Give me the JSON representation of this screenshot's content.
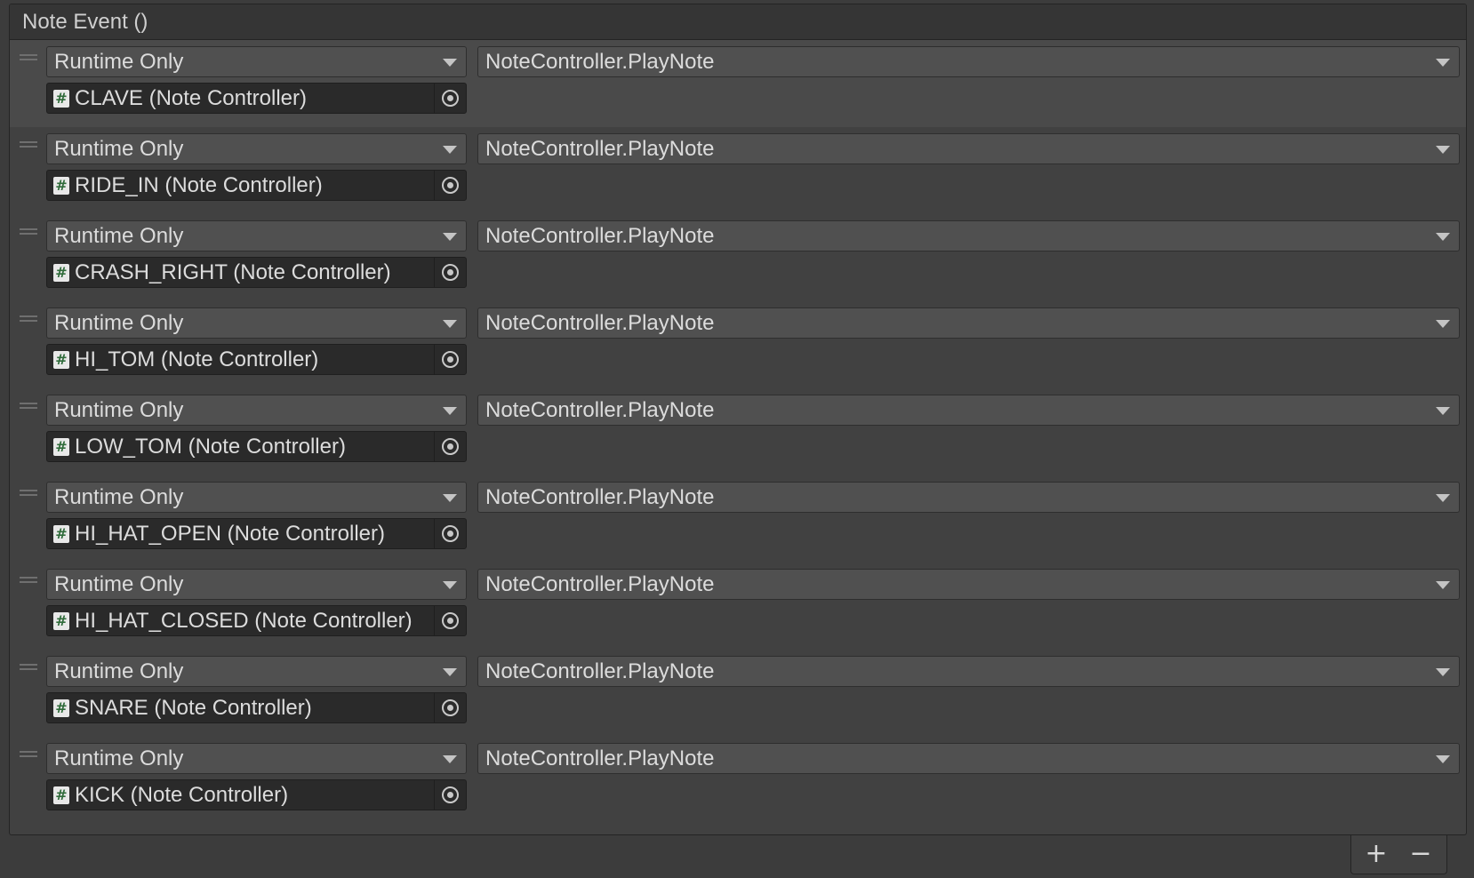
{
  "event": {
    "title": "Note Event ()",
    "listeners": [
      {
        "call_state": "Runtime Only",
        "target": "CLAVE (Note Controller)",
        "method": "NoteController.PlayNote",
        "selected": true
      },
      {
        "call_state": "Runtime Only",
        "target": "RIDE_IN (Note Controller)",
        "method": "NoteController.PlayNote",
        "selected": false
      },
      {
        "call_state": "Runtime Only",
        "target": "CRASH_RIGHT (Note Controller)",
        "method": "NoteController.PlayNote",
        "selected": false
      },
      {
        "call_state": "Runtime Only",
        "target": "HI_TOM (Note Controller)",
        "method": "NoteController.PlayNote",
        "selected": false
      },
      {
        "call_state": "Runtime Only",
        "target": "LOW_TOM (Note Controller)",
        "method": "NoteController.PlayNote",
        "selected": false
      },
      {
        "call_state": "Runtime Only",
        "target": "HI_HAT_OPEN (Note Controller)",
        "method": "NoteController.PlayNote",
        "selected": false
      },
      {
        "call_state": "Runtime Only",
        "target": "HI_HAT_CLOSED (Note Controller)",
        "method": "NoteController.PlayNote",
        "selected": false
      },
      {
        "call_state": "Runtime Only",
        "target": "SNARE (Note Controller)",
        "method": "NoteController.PlayNote",
        "selected": false
      },
      {
        "call_state": "Runtime Only",
        "target": "KICK (Note Controller)",
        "method": "NoteController.PlayNote",
        "selected": false
      }
    ]
  },
  "icons": {
    "script": "script-icon",
    "picker": "object-picker-icon",
    "drag": "drag-handle-icon",
    "dropdown": "dropdown-arrow-icon"
  },
  "footer": {
    "add_label": "+",
    "remove_label": "−"
  },
  "colors": {
    "panel_bg": "#414141",
    "header_bg": "#353535",
    "selected_row_bg": "#4a4a4a",
    "dropdown_bg": "#505050",
    "object_field_bg": "#2a2a2a",
    "script_icon_glyph": "#2f6b3a"
  }
}
